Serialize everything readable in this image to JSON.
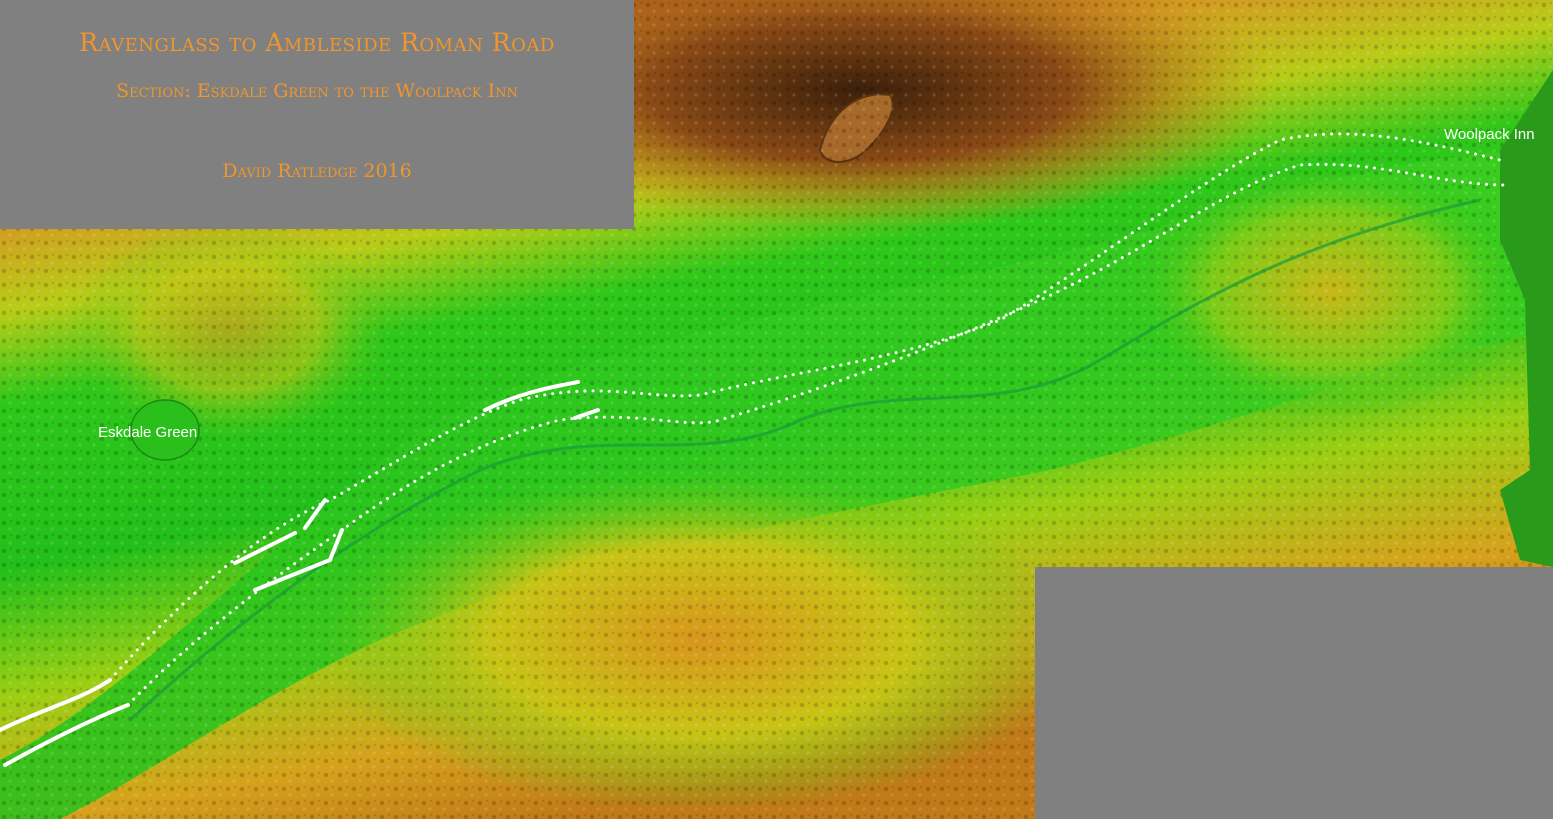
{
  "title": {
    "line1": "Ravenglass to Ambleside Roman Road",
    "line2": "Section: Eskdale Green to the Woolpack Inn",
    "line3": "David Ratledge 2016"
  },
  "places": {
    "eskdale_green": "Eskdale Green",
    "woolpack_inn": "Woolpack Inn"
  },
  "legend_colors": {
    "valley_low": "#1fbf1a",
    "mid_slope": "#c8c80f",
    "high_slope": "#d98a1a",
    "summit": "#4a2a10",
    "road_line": "#ffffff",
    "panel": "#808080",
    "title_text": "#f0962a"
  },
  "road": {
    "solid_segments": "white solid",
    "dotted_segments": "white dotted"
  }
}
